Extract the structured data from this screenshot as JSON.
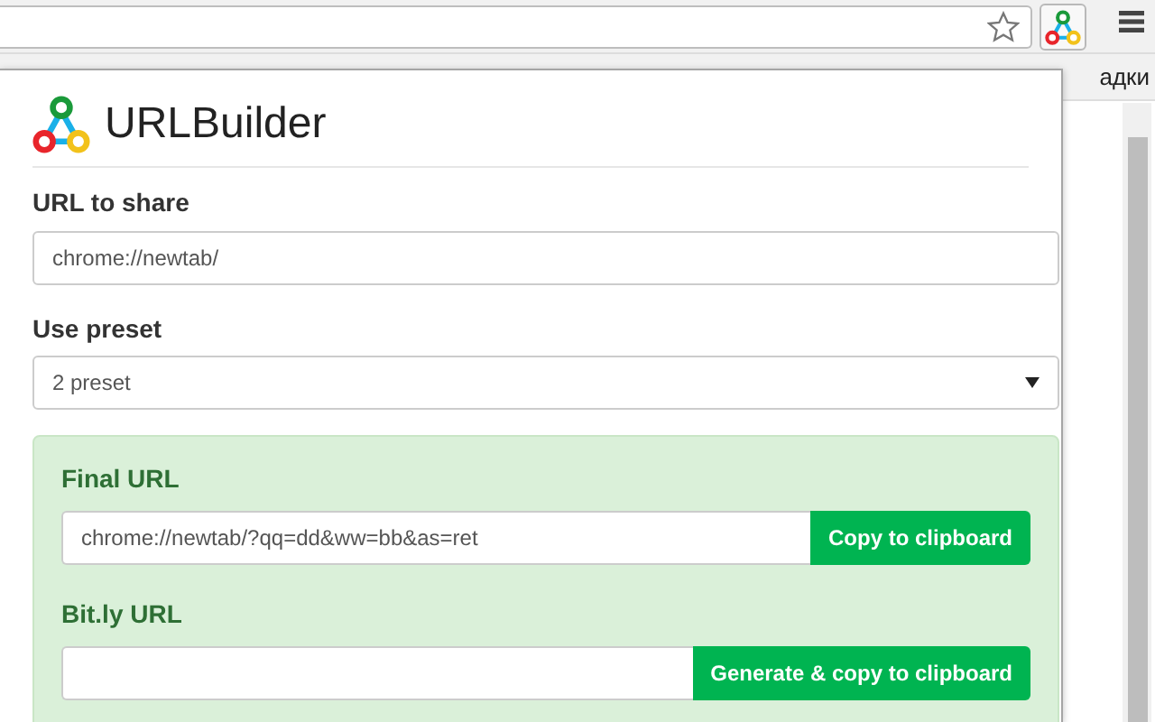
{
  "browser": {
    "bookmarks_text": "адки"
  },
  "popup": {
    "title": "URLBuilder",
    "url_to_share": {
      "label": "URL to share",
      "value": "chrome://newtab/"
    },
    "preset": {
      "label": "Use preset",
      "value": "2 preset"
    },
    "final_url": {
      "label": "Final URL",
      "value": "chrome://newtab/?qq=dd&ww=bb&as=ret",
      "button": "Copy to clipboard"
    },
    "bitly_url": {
      "label": "Bit.ly URL",
      "button": "Generate & copy to clipboard"
    }
  }
}
